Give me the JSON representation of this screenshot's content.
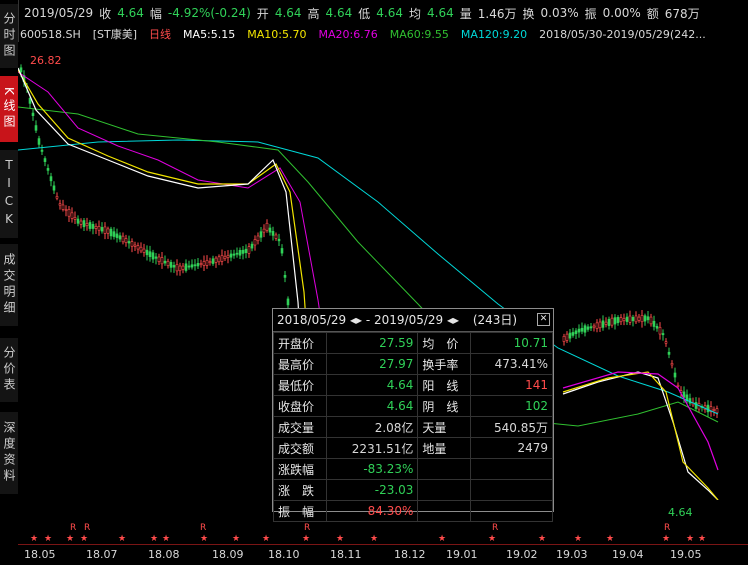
{
  "topbar": {
    "date": "2019/05/29",
    "close_label": "收",
    "close": "4.64",
    "chg_label": "幅",
    "chg": "-4.92%(-0.24)",
    "open_label": "开",
    "open": "4.64",
    "high_label": "高",
    "high": "4.64",
    "low_label": "低",
    "low": "4.64",
    "avg_label": "均",
    "avg": "4.64",
    "vol_label": "量",
    "vol": "1.46万",
    "turn_label": "换",
    "turn": "0.03%",
    "amp_label": "振",
    "amp": "0.00%",
    "amt_label": "额",
    "amt": "678万"
  },
  "mabar": {
    "code": "600518.SH",
    "name": "[ST康美]",
    "period": "日线",
    "ma5": "MA5:5.15",
    "ma10": "MA10:5.70",
    "ma20": "MA20:6.76",
    "ma60": "MA60:9.55",
    "ma120": "MA120:9.20",
    "range": "2018/05/30-2019/05/29(242..."
  },
  "sidebar": [
    {
      "label": "分时图",
      "active": false
    },
    {
      "label": "K线图",
      "active": true
    },
    {
      "label": "TICK",
      "active": false
    },
    {
      "label": "成交明细",
      "active": false
    },
    {
      "label": "分价表",
      "active": false
    },
    {
      "label": "深度资料",
      "active": false
    }
  ],
  "chart_labels": {
    "high_mark": "26.82",
    "low_mark": "4.64"
  },
  "marks": {
    "star": "★",
    "r": "R"
  },
  "xaxis": [
    "18.05",
    "18.07",
    "18.08",
    "18.09",
    "18.10",
    "18.11",
    "18.12",
    "19.01",
    "19.02",
    "19.03",
    "19.04",
    "19.05"
  ],
  "tooltip": {
    "range": "2018/05/29 ◂▸ - 2019/05/29 ◂▸",
    "days": "(243日)",
    "rows": [
      {
        "k1": "开盘价",
        "v1": "27.59",
        "c1": "down",
        "k2": "均　价",
        "v2": "10.71",
        "c2": "down"
      },
      {
        "k1": "最高价",
        "v1": "27.97",
        "c1": "down",
        "k2": "换手率",
        "v2": "473.41%",
        "c2": "neu"
      },
      {
        "k1": "最低价",
        "v1": "4.64",
        "c1": "down",
        "k2": "阳　线",
        "v2": "141",
        "c2": "up"
      },
      {
        "k1": "收盘价",
        "v1": "4.64",
        "c1": "down",
        "k2": "阴　线",
        "v2": "102",
        "c2": "down"
      },
      {
        "k1": "成交量",
        "v1": "2.08亿",
        "c1": "neu",
        "k2": "天量",
        "v2": "540.85万",
        "c2": "neu"
      },
      {
        "k1": "成交额",
        "v1": "2231.51亿",
        "c1": "neu",
        "k2": "地量",
        "v2": "2479",
        "c2": "neu"
      },
      {
        "k1": "涨跌幅",
        "v1": "-83.23%",
        "c1": "down",
        "k2": "",
        "v2": "",
        "c2": "neu"
      },
      {
        "k1": "涨　跌",
        "v1": "-23.03",
        "c1": "down",
        "k2": "",
        "v2": "",
        "c2": "neu"
      },
      {
        "k1": "振　幅",
        "v1": "84.30%",
        "c1": "up",
        "k2": "",
        "v2": "",
        "c2": "neu"
      }
    ]
  },
  "colors": {
    "ma5": "#ffffff",
    "ma10": "#f2e500",
    "ma20": "#e000e0",
    "ma60": "#30c030",
    "ma120": "#00d8d8",
    "up": "#ff4b4b",
    "down": "#30d158"
  }
}
